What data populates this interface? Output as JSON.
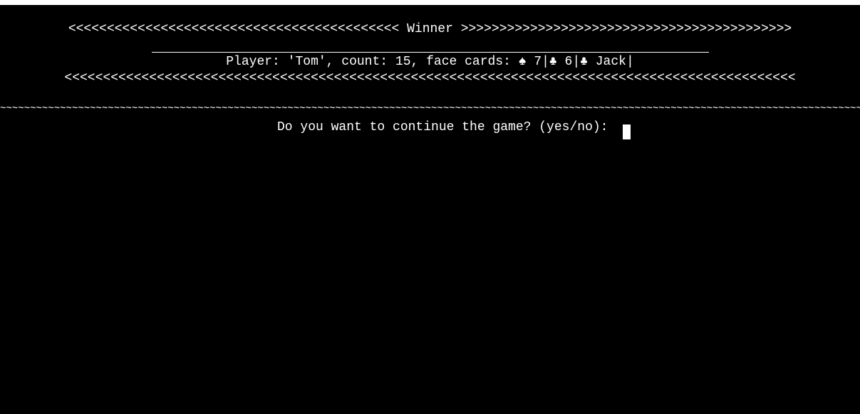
{
  "terminal": {
    "winner_banner": "<<<<<<<<<<<<<<<<<<<<<<<<<<<<<<<<<<<<<<<<<<< Winner >>>>>>>>>>>>>>>>>>>>>>>>>>>>>>>>>>>>>>>>>>>",
    "player_line": "Player: 'Tom', count: 15, face cards: ♠ 7|♣ 6|♣ Jack|",
    "bottom_banner": "<<<<<<<<<<<<<<<<<<<<<<<<<<<<<<<<<<<<<<<<<<<<<<<<<<<<<<<<<<<<<<<<<<<<<<<<<<<<<<<<<<<<<<<<<<<<<<<",
    "separator": "~~~~~~~~~~~~~~~~~~~~~~~~~~~~~~~~~~~~~~~~~~~~~~~~~~~~~~~~~~~~~~~~~~~~~~~~~~~~~~~~~~~~~~~~~~~~~~~~~~~~~~~~~~~~~~~~~~~~~~~~~~~~~~~~~~~~~~~~~~~~~~~~~",
    "prompt": "Do you want to continue the game? (yes/no): "
  }
}
